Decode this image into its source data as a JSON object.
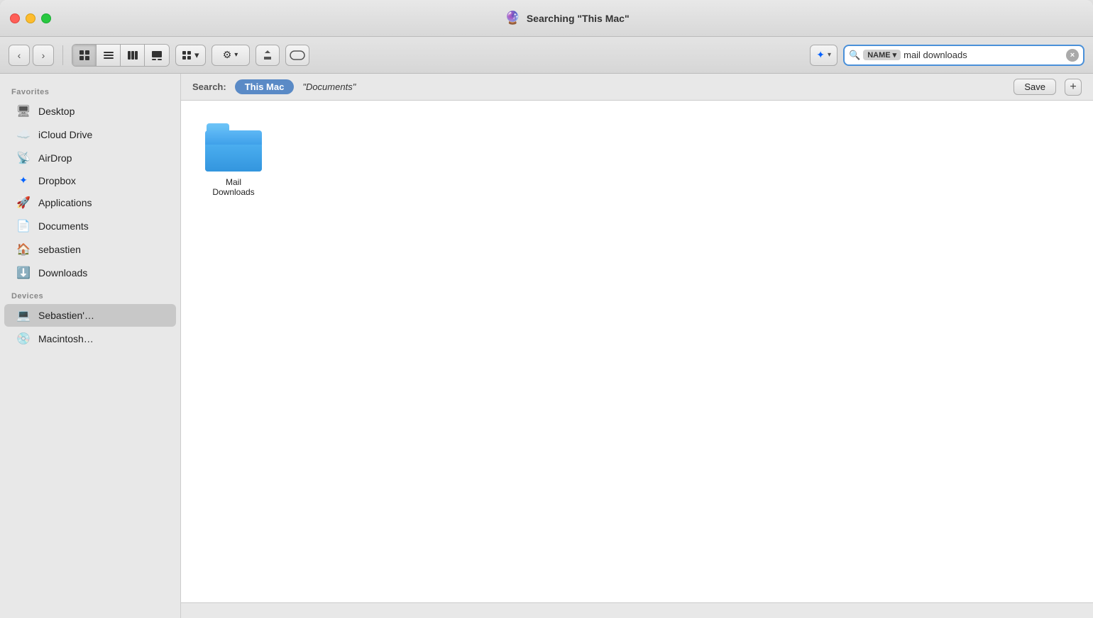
{
  "window": {
    "title": "Searching \"This Mac\"",
    "title_icon": "🔮"
  },
  "traffic_lights": {
    "close_label": "×",
    "minimize_label": "–",
    "maximize_label": "+"
  },
  "toolbar": {
    "back_label": "‹",
    "forward_label": "›",
    "view_icon_grid": "⊞",
    "view_icon_list": "≡",
    "view_icon_column": "⊟",
    "view_icon_cover": "⊡",
    "view_group_label": "⊞",
    "view_group_chevron": "▾",
    "action_settings_label": "⚙",
    "action_settings_chevron": "▾",
    "action_share_label": "↑",
    "action_back_label": "⬅",
    "dropbox_icon": "📦",
    "dropbox_chevron": "▾",
    "search_icon": "🔍",
    "search_name_label": "NAME",
    "search_name_chevron": "▾",
    "search_value": "mail downloads",
    "search_clear_label": "×"
  },
  "search_filter": {
    "label": "Search:",
    "scope_this_mac": "This Mac",
    "scope_documents": "\"Documents\"",
    "save_label": "Save",
    "add_label": "+"
  },
  "sidebar": {
    "favorites_label": "Favorites",
    "items": [
      {
        "id": "desktop",
        "label": "Desktop",
        "icon": "🖥"
      },
      {
        "id": "icloud-drive",
        "label": "iCloud Drive",
        "icon": "☁"
      },
      {
        "id": "airdrop",
        "label": "AirDrop",
        "icon": "📡"
      },
      {
        "id": "dropbox",
        "label": "Dropbox",
        "icon": "📁"
      },
      {
        "id": "applications",
        "label": "Applications",
        "icon": "🚀"
      },
      {
        "id": "documents",
        "label": "Documents",
        "icon": "📄"
      },
      {
        "id": "sebastien",
        "label": "sebastien",
        "icon": "🏠"
      },
      {
        "id": "downloads",
        "label": "Downloads",
        "icon": "⬇"
      }
    ],
    "devices_label": "Devices",
    "devices": [
      {
        "id": "sebastien-mac",
        "label": "Sebastien'…",
        "icon": "💻",
        "active": true
      },
      {
        "id": "macintosh",
        "label": "Macintosh…",
        "icon": "💿"
      }
    ]
  },
  "files": [
    {
      "id": "mail-downloads",
      "name": "Mail Downloads",
      "type": "folder"
    }
  ],
  "status_bar": {
    "text": ""
  }
}
